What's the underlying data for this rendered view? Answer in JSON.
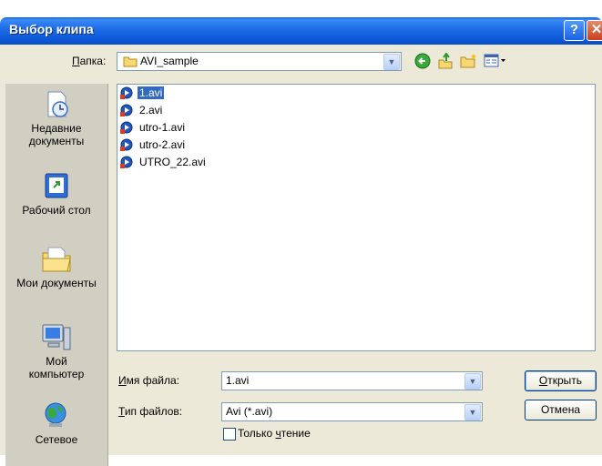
{
  "window": {
    "title": "Выбор клипа",
    "help_label": "?",
    "close_label": "✕"
  },
  "toolbar": {
    "folder_label_hotkey": "П",
    "folder_label_rest": "апка:",
    "folder_value": "AVI_sample",
    "icons": [
      "back-icon",
      "up-folder-icon",
      "new-folder-icon",
      "views-menu-icon"
    ]
  },
  "places": [
    {
      "id": "recent",
      "label_line1": "Недавние",
      "label_line2": "документы"
    },
    {
      "id": "desktop",
      "label_line1": "Рабочий стол",
      "label_line2": ""
    },
    {
      "id": "mydocs",
      "label_line1": "Мои документы",
      "label_line2": ""
    },
    {
      "id": "mycomputer",
      "label_line1": "Мой",
      "label_line2": "компьютер"
    },
    {
      "id": "network",
      "label_line1": "Сетевое",
      "label_line2": ""
    }
  ],
  "files": [
    {
      "name": "1.avi",
      "selected": true
    },
    {
      "name": "2.avi",
      "selected": false
    },
    {
      "name": "utro-1.avi",
      "selected": false
    },
    {
      "name": "utro-2.avi",
      "selected": false
    },
    {
      "name": "UTRO_22.avi",
      "selected": false
    }
  ],
  "filename": {
    "label_hotkey": "И",
    "label_rest": "мя файла:",
    "value": "1.avi"
  },
  "filetype": {
    "label_hotkey": "Т",
    "label_rest": "ип файлов:",
    "value": "Avi (*.avi)"
  },
  "readonly": {
    "label_pre": "Только ",
    "label_hotkey": "ч",
    "label_post": "тение",
    "checked": false
  },
  "buttons": {
    "open_hotkey": "О",
    "open_rest": "ткрыть",
    "cancel": "Отмена"
  },
  "colors": {
    "title_bar": "#0b56d6",
    "dialog_bg": "#ece9d8",
    "selection": "#316ac5",
    "places_bg": "#d1cfc2"
  }
}
